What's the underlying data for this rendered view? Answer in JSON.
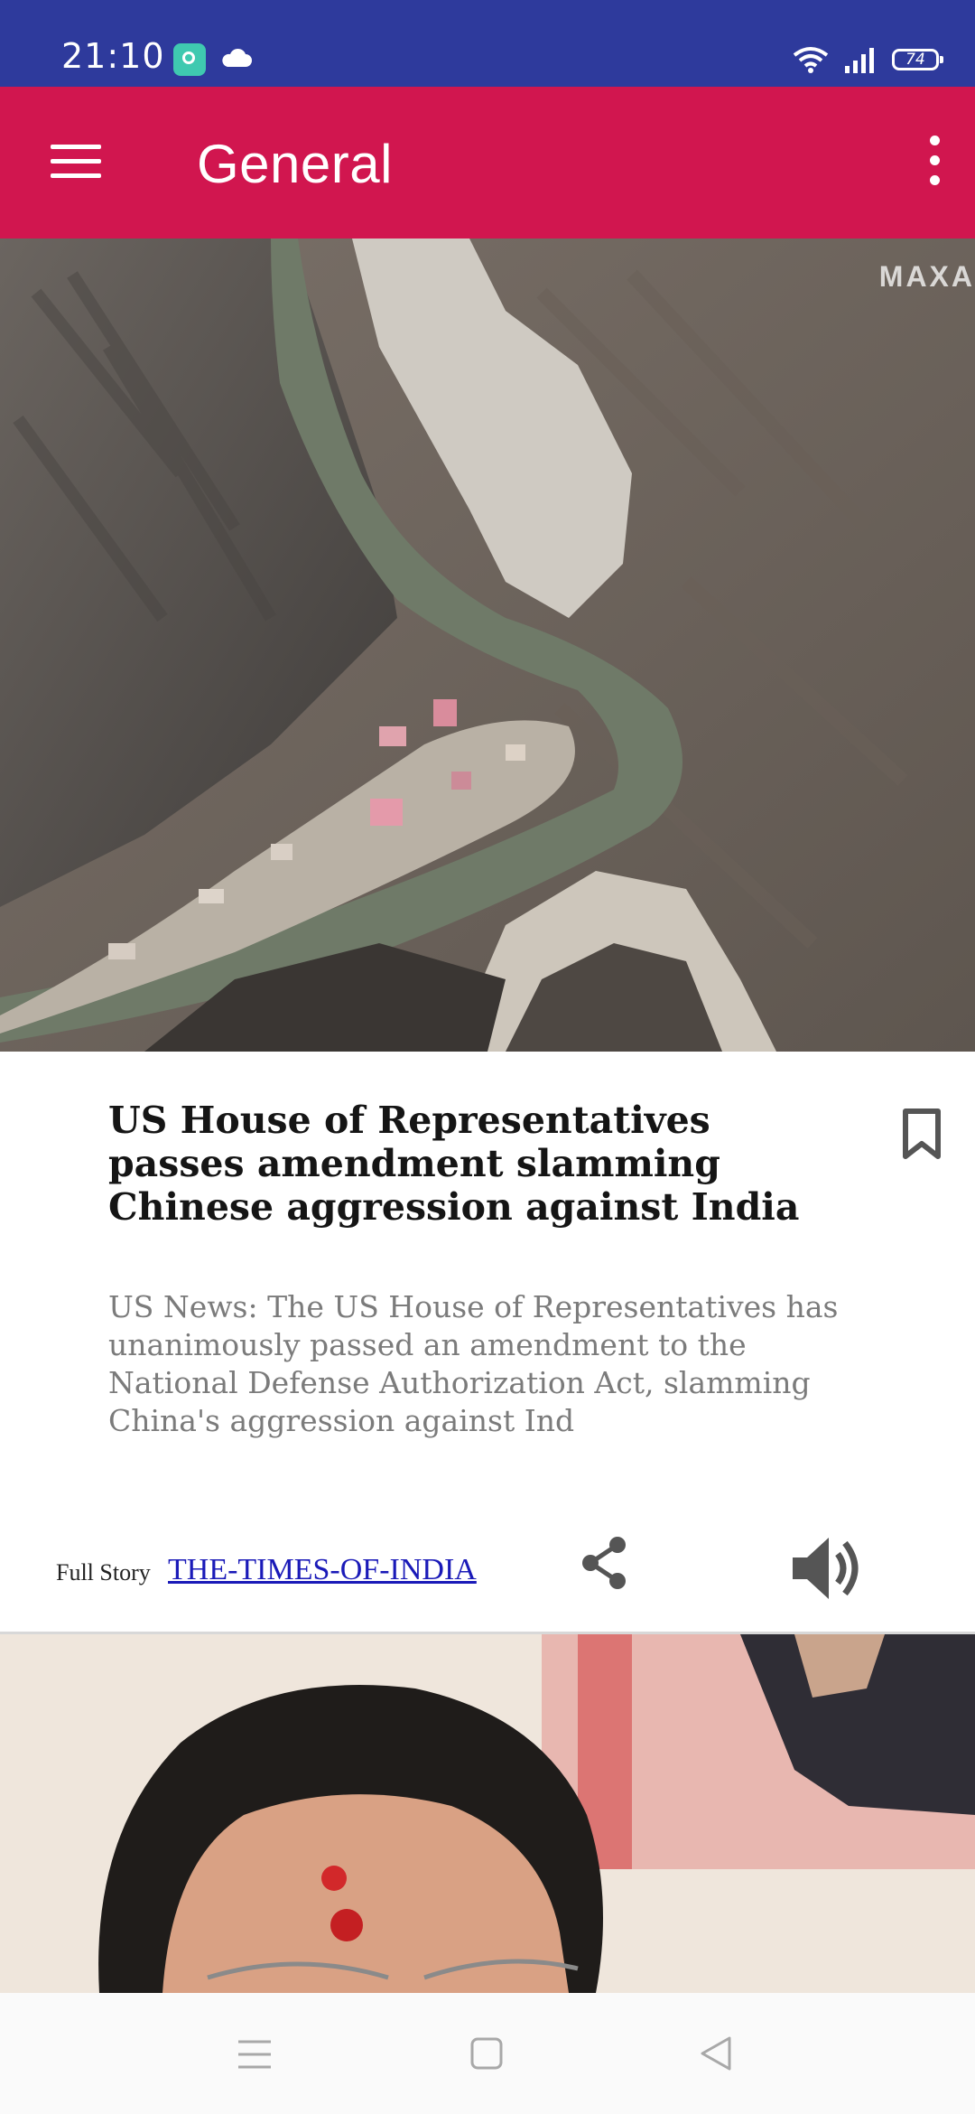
{
  "status_bar": {
    "time": "21:10",
    "battery": "74",
    "icons": [
      "app-notification-icon",
      "cloud-icon",
      "wifi-icon",
      "signal-icon",
      "battery-icon"
    ]
  },
  "app_bar": {
    "title": "General",
    "icons": [
      "menu-icon",
      "overflow-menu-icon"
    ],
    "background": "#d1164f"
  },
  "article": {
    "image_watermark": "MAXA",
    "title": "US House of Representatives passes amendment slamming Chinese aggression against India",
    "summary": "US News: The US House of Representatives has unanimously passed an amendment to the National Defense Authorization Act, slamming China's aggression against Ind",
    "full_story_label": "Full Story",
    "source": "THE-TIMES-OF-INDIA",
    "icons": [
      "bookmark-icon",
      "share-icon",
      "speaker-icon"
    ]
  },
  "navigation": {
    "icons": [
      "recents-icon",
      "home-icon",
      "back-icon"
    ]
  },
  "colors": {
    "status_bar": "#2e3a9c",
    "app_bar": "#d1164f",
    "link": "#1a1ab8",
    "summary_text": "#7b7b7b"
  }
}
